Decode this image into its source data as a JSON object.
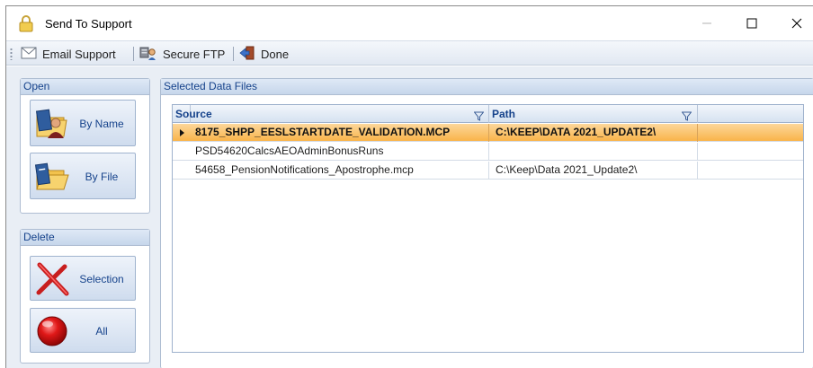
{
  "window": {
    "title": "Send To Support",
    "controls": [
      "minimize",
      "maximize",
      "close"
    ]
  },
  "toolbar": {
    "email_label": "Email Support",
    "ftp_label": "Secure FTP",
    "done_label": "Done"
  },
  "open_group": {
    "title": "Open",
    "by_name_label": "By Name",
    "by_file_label": "By File"
  },
  "delete_group": {
    "title": "Delete",
    "selection_label": "Selection",
    "all_label": "All"
  },
  "files_panel": {
    "title": "Selected Data Files",
    "columns": [
      "Source",
      "Path"
    ],
    "rows": [
      {
        "source": "8175_SHPP_EESLSTARTDATE_VALIDATION.MCP",
        "path": "C:\\KEEP\\DATA 2021_UPDATE2\\",
        "selected": true
      },
      {
        "source": "PSD54620CalcsAEOAdminBonusRuns",
        "path": "",
        "selected": false
      },
      {
        "source": "54658_PensionNotifications_Apostrophe.mcp",
        "path": "C:\\Keep\\Data 2021_Update2\\",
        "selected": false
      }
    ]
  },
  "colors": {
    "accent_text": "#15428b",
    "selection_highlight": "#f9b44a",
    "panel_header": "#c6d6eb"
  },
  "icons": {
    "title": "lock-icon",
    "email": "envelope-icon",
    "ftp": "secure-ftp-icon",
    "done": "door-exit-icon",
    "by_name": "person-folder-icon",
    "by_file": "document-folder-icon",
    "selection": "red-x-icon",
    "all": "red-circle-icon",
    "filter": "filter-icon",
    "row_indicator": "row-pointer-icon"
  }
}
